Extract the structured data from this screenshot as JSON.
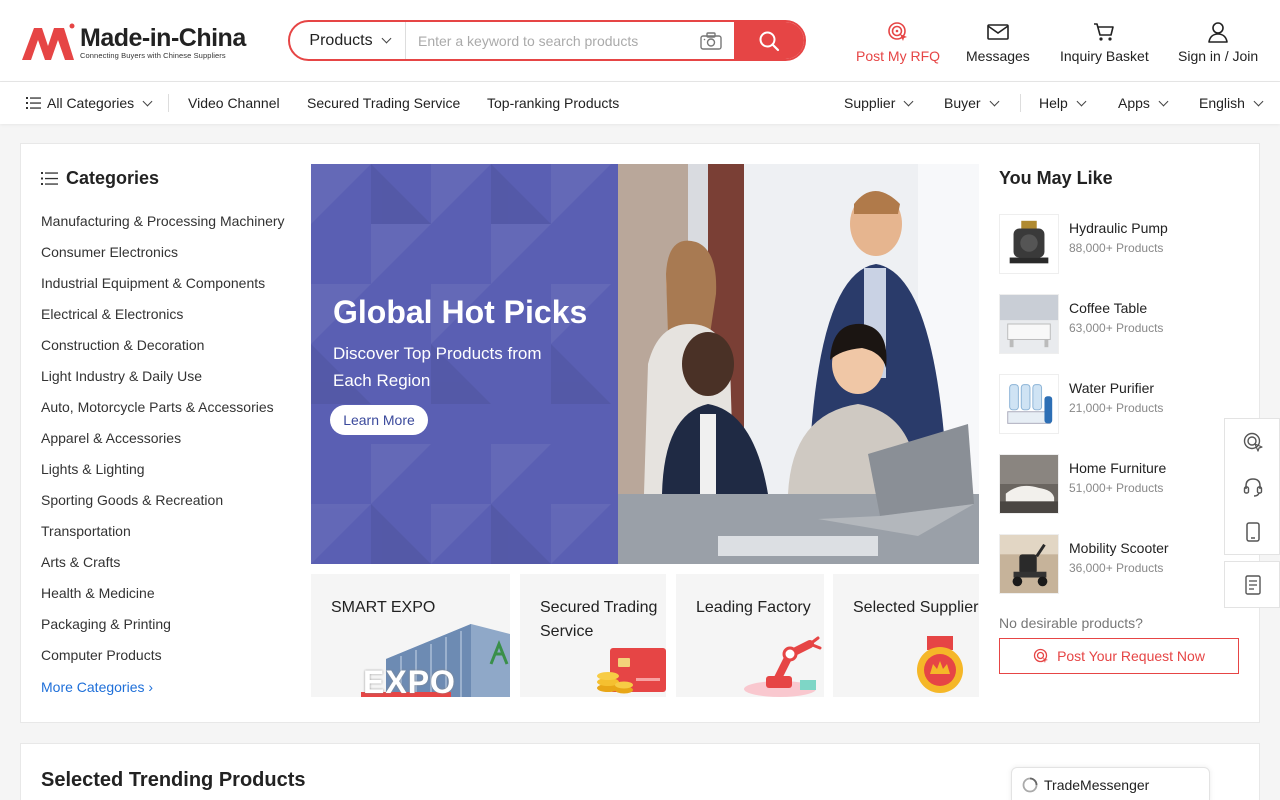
{
  "brand": {
    "name": "Made-in-China",
    "tagline": "Connecting Buyers with Chinese Suppliers",
    "accent": "#e64545"
  },
  "search": {
    "type_label": "Products",
    "placeholder": "Enter a keyword to search products"
  },
  "header_actions": [
    {
      "label": "Post My RFQ",
      "icon": "rfq-target-icon"
    },
    {
      "label": "Messages",
      "icon": "envelope-icon"
    },
    {
      "label": "Inquiry Basket",
      "icon": "cart-icon"
    },
    {
      "label": "Sign in / Join",
      "icon": "user-icon"
    }
  ],
  "nav": {
    "all_categories": "All Categories",
    "left_links": [
      "Video Channel",
      "Secured Trading Service",
      "Top-ranking Products"
    ],
    "right_menus": [
      "Supplier",
      "Buyer",
      "Help",
      "Apps",
      "English"
    ]
  },
  "categories": {
    "title": "Categories",
    "items": [
      "Manufacturing & Processing Machinery",
      "Consumer Electronics",
      "Industrial Equipment & Components",
      "Electrical & Electronics",
      "Construction & Decoration",
      "Light Industry & Daily Use",
      "Auto, Motorcycle Parts & Accessories",
      "Apparel & Accessories",
      "Lights & Lighting",
      "Sporting Goods & Recreation",
      "Transportation",
      "Arts & Crafts",
      "Health & Medicine",
      "Packaging & Printing",
      "Computer Products"
    ],
    "more": "More Categories"
  },
  "banner": {
    "title": "Global Hot Picks",
    "subtitle": "Discover Top Products from Each Region",
    "button": "Learn More",
    "color": "#5a5fb3"
  },
  "tiles": [
    {
      "label": "SMART EXPO",
      "overlay": "EXPO"
    },
    {
      "label": "Secured Trading Service"
    },
    {
      "label": "Leading Factory"
    },
    {
      "label": "Selected Supplier"
    }
  ],
  "you_may_like": {
    "title": "You May Like",
    "items": [
      {
        "name": "Hydraulic Pump",
        "count": "88,000+ Products"
      },
      {
        "name": "Coffee Table",
        "count": "63,000+ Products"
      },
      {
        "name": "Water Purifier",
        "count": "21,000+ Products"
      },
      {
        "name": "Home Furniture",
        "count": "51,000+ Products"
      },
      {
        "name": "Mobility Scooter",
        "count": "36,000+ Products"
      }
    ],
    "no_desire": "No desirable products?",
    "post_request": "Post Your Request Now"
  },
  "side_tools": [
    "rfq-icon",
    "headset-icon",
    "mobile-icon",
    "form-icon"
  ],
  "trending": {
    "title": "Selected Trending Products"
  },
  "trade_messenger": "TradeMessenger"
}
